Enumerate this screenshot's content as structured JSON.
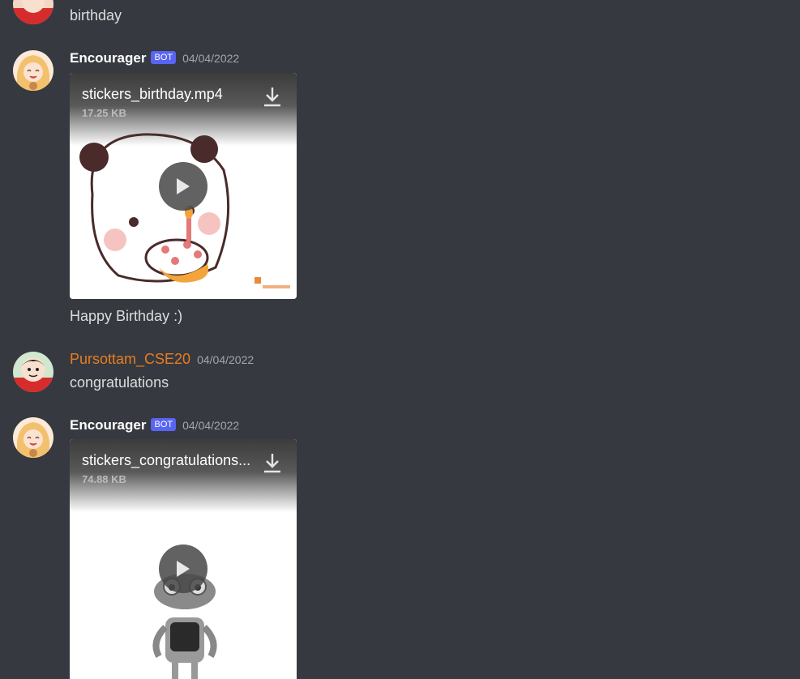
{
  "messages": [
    {
      "author": "",
      "timestamp": "",
      "text": "birthday"
    },
    {
      "author": "Encourager",
      "bot_label": "BOT",
      "timestamp": "04/04/2022",
      "attachment": {
        "filename": "stickers_birthday.mp4",
        "size": "17.25 KB"
      },
      "text": "Happy Birthday :)"
    },
    {
      "author": "Pursottam_CSE20",
      "timestamp": "04/04/2022",
      "text": "congratulations"
    },
    {
      "author": "Encourager",
      "bot_label": "BOT",
      "timestamp": "04/04/2022",
      "attachment": {
        "filename": "stickers_congratulations...",
        "size": "74.88 KB"
      }
    }
  ],
  "icons": {
    "download": "download-icon",
    "play": "play-icon"
  },
  "colors": {
    "background": "#36393f",
    "bot_tag": "#5865f2",
    "username_orange": "#e67e22",
    "timestamp": "#a3a6aa"
  }
}
